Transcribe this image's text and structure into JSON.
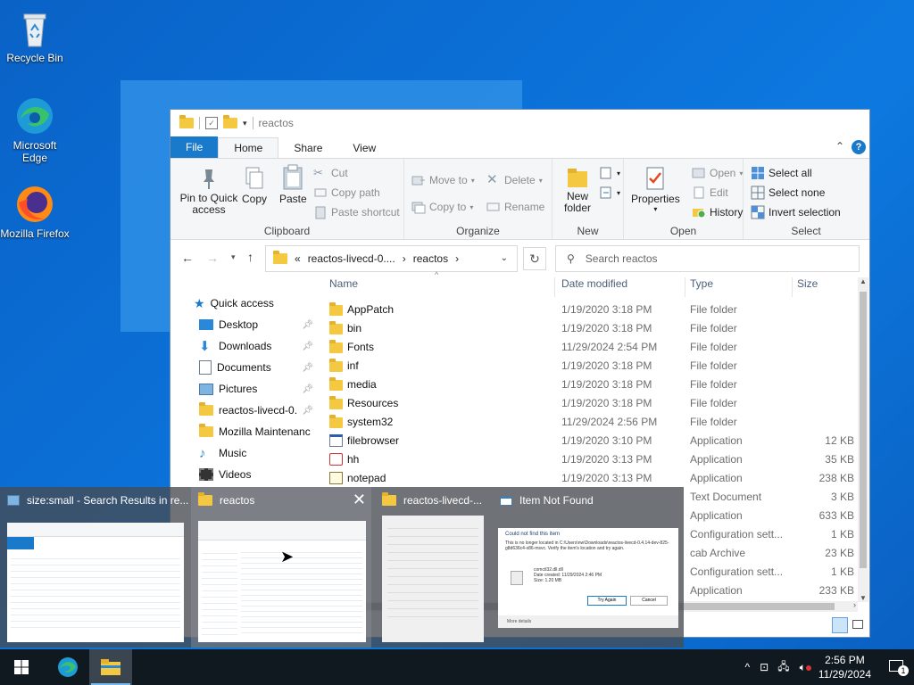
{
  "desktop": {
    "icons": [
      {
        "label": "Recycle Bin",
        "icon": "recycle-bin-icon"
      },
      {
        "label": "Microsoft Edge",
        "icon": "edge-icon"
      },
      {
        "label": "Mozilla Firefox",
        "icon": "firefox-icon"
      }
    ]
  },
  "explorer": {
    "title": "reactos",
    "tabs": {
      "file": "File",
      "home": "Home",
      "share": "Share",
      "view": "View"
    },
    "ribbon": {
      "clipboard": {
        "title": "Clipboard",
        "pin": "Pin to Quick access",
        "copy": "Copy",
        "paste": "Paste",
        "cut": "Cut",
        "copy_path": "Copy path",
        "paste_shortcut": "Paste shortcut"
      },
      "organize": {
        "title": "Organize",
        "move_to": "Move to",
        "copy_to": "Copy to",
        "delete": "Delete",
        "rename": "Rename"
      },
      "new": {
        "title": "New",
        "new_folder": "New folder"
      },
      "open": {
        "title": "Open",
        "properties": "Properties",
        "open": "Open",
        "edit": "Edit",
        "history": "History"
      },
      "select": {
        "title": "Select",
        "select_all": "Select all",
        "select_none": "Select none",
        "invert": "Invert selection"
      }
    },
    "address": {
      "parent": "reactos-livecd-0....",
      "current": "reactos"
    },
    "search": {
      "placeholder": "Search reactos"
    },
    "nav": [
      {
        "label": "Quick access",
        "pinned": false
      },
      {
        "label": "Desktop",
        "pinned": true
      },
      {
        "label": "Downloads",
        "pinned": true
      },
      {
        "label": "Documents",
        "pinned": true
      },
      {
        "label": "Pictures",
        "pinned": true
      },
      {
        "label": "reactos-livecd-0.",
        "pinned": true
      },
      {
        "label": "Mozilla Maintenanc",
        "pinned": false
      },
      {
        "label": "Music",
        "pinned": false
      },
      {
        "label": "Videos",
        "pinned": false
      }
    ],
    "columns": {
      "name": "Name",
      "date": "Date modified",
      "type": "Type",
      "size": "Size"
    },
    "files": [
      {
        "name": "AppPatch",
        "date": "1/19/2020 3:18 PM",
        "type": "File folder",
        "size": "",
        "kind": "folder"
      },
      {
        "name": "bin",
        "date": "1/19/2020 3:18 PM",
        "type": "File folder",
        "size": "",
        "kind": "folder"
      },
      {
        "name": "Fonts",
        "date": "11/29/2024 2:54 PM",
        "type": "File folder",
        "size": "",
        "kind": "folder"
      },
      {
        "name": "inf",
        "date": "1/19/2020 3:18 PM",
        "type": "File folder",
        "size": "",
        "kind": "folder"
      },
      {
        "name": "media",
        "date": "1/19/2020 3:18 PM",
        "type": "File folder",
        "size": "",
        "kind": "folder"
      },
      {
        "name": "Resources",
        "date": "1/19/2020 3:18 PM",
        "type": "File folder",
        "size": "",
        "kind": "folder"
      },
      {
        "name": "system32",
        "date": "11/29/2024 2:56 PM",
        "type": "File folder",
        "size": "",
        "kind": "folder"
      },
      {
        "name": "filebrowser",
        "date": "1/19/2020 3:10 PM",
        "type": "Application",
        "size": "12 KB",
        "kind": "app"
      },
      {
        "name": "hh",
        "date": "1/19/2020 3:13 PM",
        "type": "Application",
        "size": "35 KB",
        "kind": "app2"
      },
      {
        "name": "notepad",
        "date": "1/19/2020 3:13 PM",
        "type": "Application",
        "size": "238 KB",
        "kind": "notepad"
      },
      {
        "name": "",
        "date": "",
        "type": "Text Document",
        "size": "3 KB",
        "kind": "none"
      },
      {
        "name": "",
        "date": "",
        "type": "Application",
        "size": "633 KB",
        "kind": "none"
      },
      {
        "name": "",
        "date": "",
        "type": "Configuration sett...",
        "size": "1 KB",
        "kind": "none"
      },
      {
        "name": "",
        "date": "",
        "type": "cab Archive",
        "size": "23 KB",
        "kind": "none"
      },
      {
        "name": "",
        "date": "",
        "type": "Configuration sett...",
        "size": "1 KB",
        "kind": "none"
      },
      {
        "name": "",
        "date": "",
        "type": "Application",
        "size": "233 KB",
        "kind": "none"
      }
    ]
  },
  "thumbnails": [
    {
      "title": "size:small - Search Results in re...",
      "icon": "explorer-search-icon"
    },
    {
      "title": "reactos",
      "icon": "folder-icon"
    },
    {
      "title": "reactos-livecd-...",
      "icon": "folder-icon"
    },
    {
      "title": "Item Not Found",
      "icon": "dialog-icon"
    }
  ],
  "dialog_preview": {
    "heading": "Could not find this item",
    "body": "This is no longer located in C:\\Users\\nw\\Downloads\\reactos-livecd-0.4.14-dev-825-g8d636c4-x86-msvc. Verify the item's location and try again.",
    "file": "comctl32.dll.dll",
    "created": "Date created: 11/29/2024 2:46 PM",
    "size": "Size: 1.20 MB",
    "try_again": "Try Again",
    "cancel": "Cancel",
    "more": "More details"
  },
  "taskbar": {
    "time": "2:56 PM",
    "date": "11/29/2024",
    "notifications": "1"
  },
  "colors": {
    "accent": "#1979ca",
    "taskbar": "#101820",
    "folder": "#f5c842"
  }
}
